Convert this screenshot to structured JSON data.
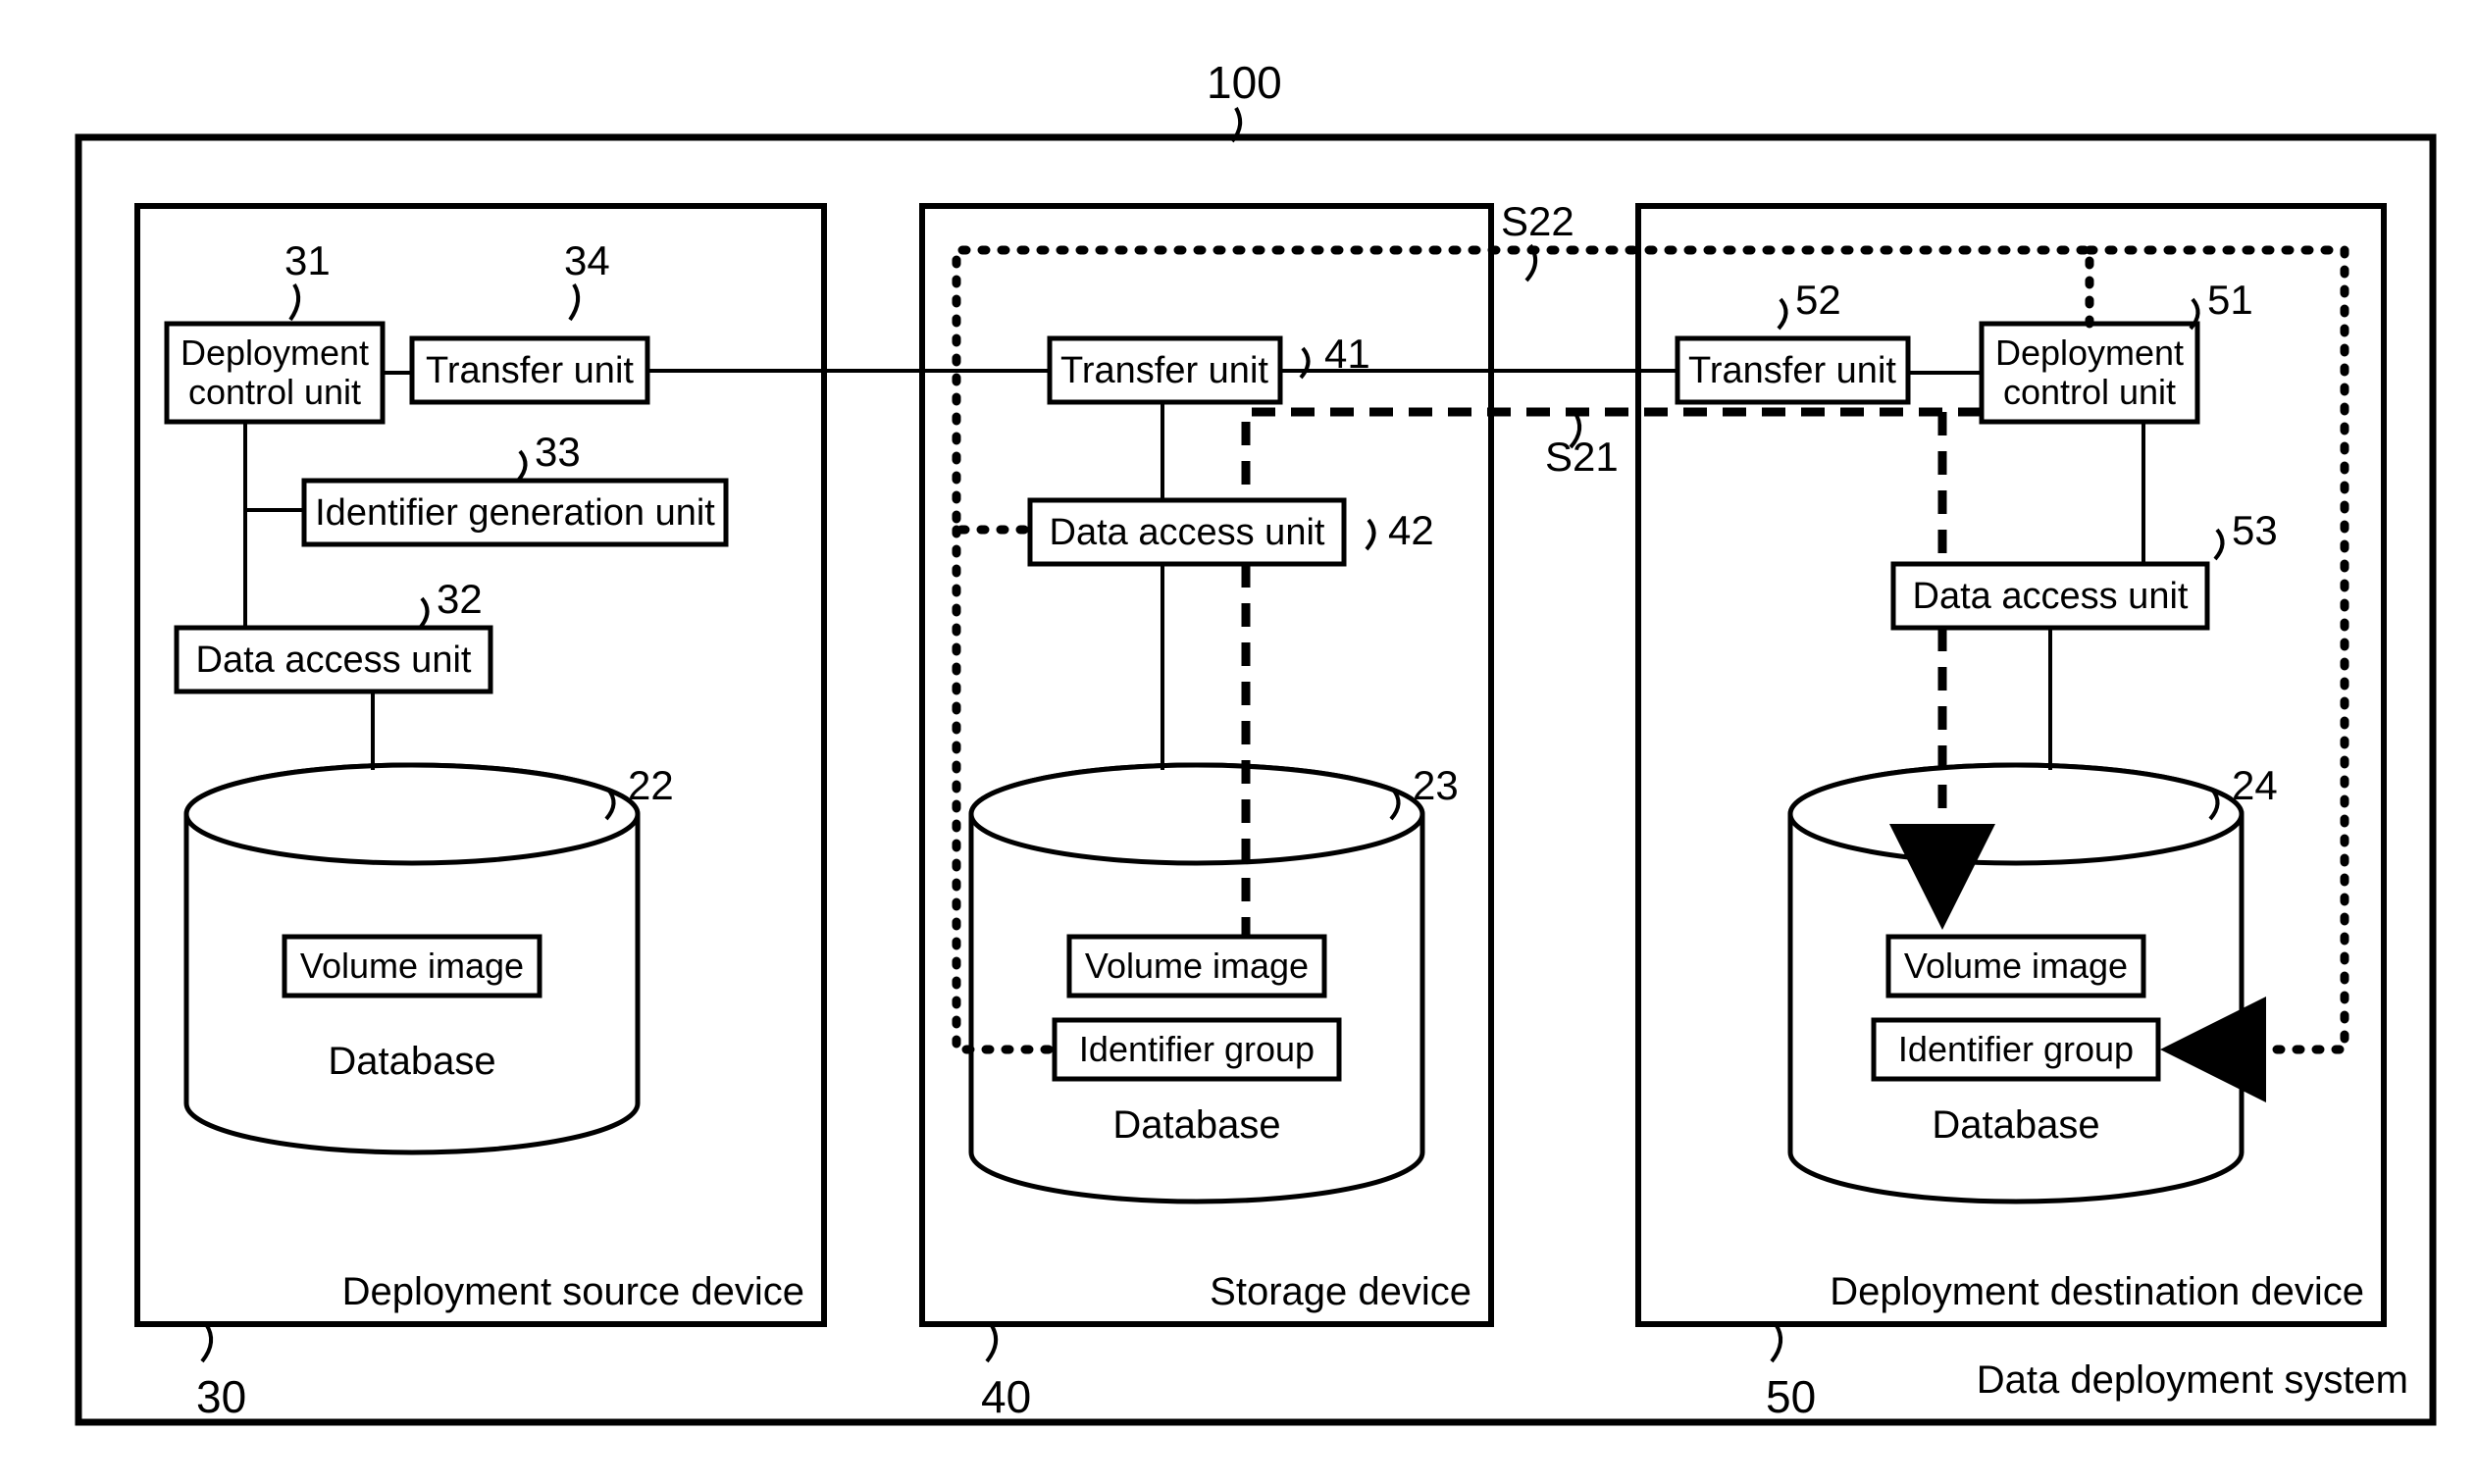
{
  "system": {
    "ref": "100",
    "title": "Data deployment system"
  },
  "source": {
    "ref": "30",
    "title": "Deployment source device",
    "deploy_ctrl": {
      "ref": "31",
      "label_l1": "Deployment",
      "label_l2": "control unit"
    },
    "transfer": {
      "ref": "34",
      "label": "Transfer unit"
    },
    "id_gen": {
      "ref": "33",
      "label": "Identifier generation unit"
    },
    "data_access": {
      "ref": "32",
      "label": "Data access unit"
    },
    "db": {
      "ref": "22",
      "label": "Database",
      "volume": "Volume image"
    }
  },
  "storage": {
    "ref": "40",
    "title": "Storage device",
    "transfer": {
      "ref": "41",
      "label": "Transfer unit"
    },
    "data_access": {
      "ref": "42",
      "label": "Data access unit"
    },
    "db": {
      "ref": "23",
      "label": "Database",
      "volume": "Volume image",
      "idgroup": "Identifier group"
    }
  },
  "dest": {
    "ref": "50",
    "title": "Deployment destination device",
    "deploy_ctrl": {
      "ref": "51",
      "label_l1": "Deployment",
      "label_l2": "control unit"
    },
    "transfer": {
      "ref": "52",
      "label": "Transfer unit"
    },
    "data_access": {
      "ref": "53",
      "label": "Data access unit"
    },
    "db": {
      "ref": "24",
      "label": "Database",
      "volume": "Volume image",
      "idgroup": "Identifier group"
    }
  },
  "flows": {
    "s21": "S21",
    "s22": "S22"
  }
}
